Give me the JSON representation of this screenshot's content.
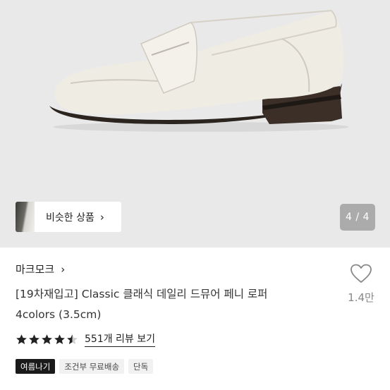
{
  "gallery": {
    "similar_label": "비슷한 상품",
    "counter": "4 / 4",
    "image_subject": "ivory penny loafer"
  },
  "product": {
    "brand": "마크모크",
    "title_line1": "[19차재입고] Classic 클래식 데일리 드뮤어 페니 로퍼",
    "title_line2": "4colors (3.5cm)",
    "likes": "1.4만",
    "rating": 4.5,
    "reviews_label": "551개 리뷰 보기"
  },
  "badges": [
    {
      "label": "여름나기",
      "style": "dark"
    },
    {
      "label": "조건부 무료배송",
      "style": "light"
    },
    {
      "label": "단독",
      "style": "light"
    }
  ],
  "colors": {
    "gallery_bg": "#e9e9e9",
    "shoe_upper": "#efece4",
    "sole": "#2b241f",
    "star": "#222222"
  }
}
